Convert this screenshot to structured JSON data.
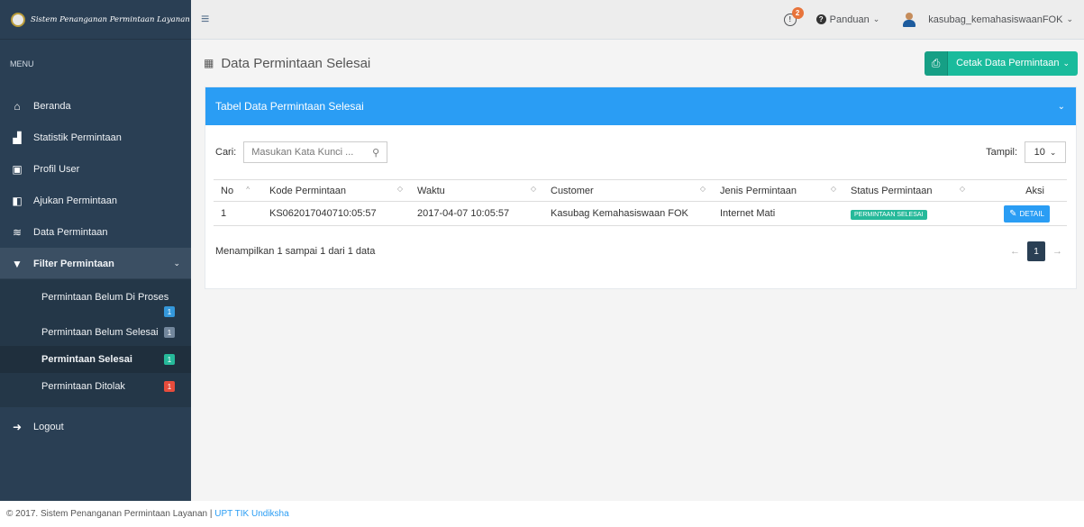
{
  "brand": {
    "title": "Sistem Penanganan Permintaan Layanan"
  },
  "sidebar": {
    "menu_heading": "MENU",
    "items": [
      {
        "label": "Beranda",
        "icon": "home-icon"
      },
      {
        "label": "Statistik Permintaan",
        "icon": "bar-chart-icon"
      },
      {
        "label": "Profil User",
        "icon": "profile-icon"
      },
      {
        "label": "Ajukan Permintaan",
        "icon": "request-icon"
      },
      {
        "label": "Data Permintaan",
        "icon": "database-icon"
      },
      {
        "label": "Filter Permintaan",
        "icon": "filter-icon"
      }
    ],
    "submenu": [
      {
        "label": "Permintaan Belum Di Proses",
        "count": "1",
        "color": "#3498db"
      },
      {
        "label": "Permintaan Belum Selesai",
        "count": "1",
        "color": "#73879c"
      },
      {
        "label": "Permintaan Selesai",
        "count": "1",
        "color": "#26b99a"
      },
      {
        "label": "Permintaan Ditolak",
        "count": "1",
        "color": "#e74c3c"
      }
    ],
    "logout_label": "Logout"
  },
  "topnav": {
    "notif_count": "2",
    "notif_symbol": "!",
    "help_label": "Panduan",
    "user_label": "kasubag_kemahasiswaanFOK"
  },
  "page": {
    "title": "Data Permintaan Selesai",
    "print_label": "Cetak Data Permintaan"
  },
  "panel": {
    "heading": "Tabel Data Permintaan Selesai",
    "search_label": "Cari:",
    "search_placeholder": "Masukan Kata Kunci ...",
    "show_label": "Tampil:",
    "show_value": "10",
    "columns": [
      "No",
      "Kode Permintaan",
      "Waktu",
      "Customer",
      "Jenis Permintaan",
      "Status Permintaan",
      "Aksi"
    ],
    "rows": [
      {
        "no": "1",
        "kode": "KS062017040710:05:57",
        "waktu": "2017-04-07 10:05:57",
        "customer": "Kasubag Kemahasiswaan FOK",
        "jenis": "Internet Mati",
        "status": "PERMINTAAN SELESAI",
        "aksi": "DETAIL"
      }
    ],
    "info": "Menampilkan 1 sampai 1 dari 1 data",
    "current_page": "1"
  },
  "footer": {
    "text": "© 2017. Sistem Penanganan Permintaan Layanan | ",
    "link": "UPT TIK Undiksha"
  },
  "colors": {
    "accent": "#2a9df4",
    "sidebar": "#2a3f54",
    "success": "#1abb9c"
  }
}
